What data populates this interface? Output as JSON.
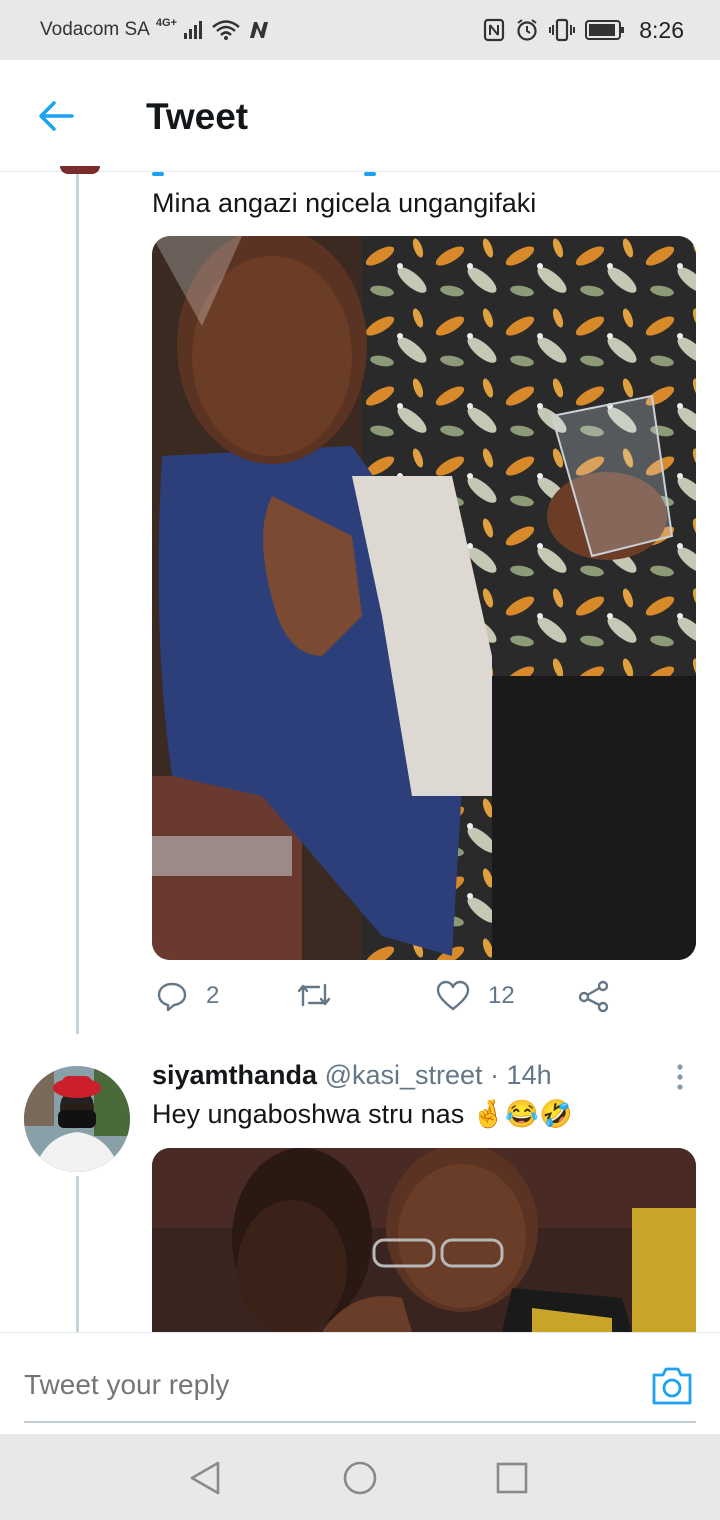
{
  "status_bar": {
    "carrier": "Vodacom SA",
    "network": "4G",
    "network_suffix": "+",
    "time": "8:26",
    "icons": [
      "signal-icon",
      "wifi-icon",
      "n-app-icon",
      "nfc-icon",
      "alarm-icon",
      "vibrate-icon",
      "battery-icon"
    ]
  },
  "header": {
    "back_icon": "arrow-left-icon",
    "title": "Tweet"
  },
  "thread": [
    {
      "text": "Mina angazi ngicela ungangifaki",
      "media_description": "photo",
      "actions": {
        "reply_count": "2",
        "retweet_count": "",
        "like_count": "12"
      }
    },
    {
      "display_name": "siyamthanda",
      "handle": "@kasi_street",
      "separator": " · ",
      "time": "14h",
      "text": "Hey ungaboshwa stru nas",
      "emojis": "🤞😂🤣"
    }
  ],
  "reply": {
    "placeholder": "Tweet your reply",
    "camera_icon": "camera-icon"
  },
  "colors": {
    "accent": "#1da1f2",
    "muted": "#657786",
    "text": "#14171a",
    "system_bar": "#e8e8e8"
  }
}
